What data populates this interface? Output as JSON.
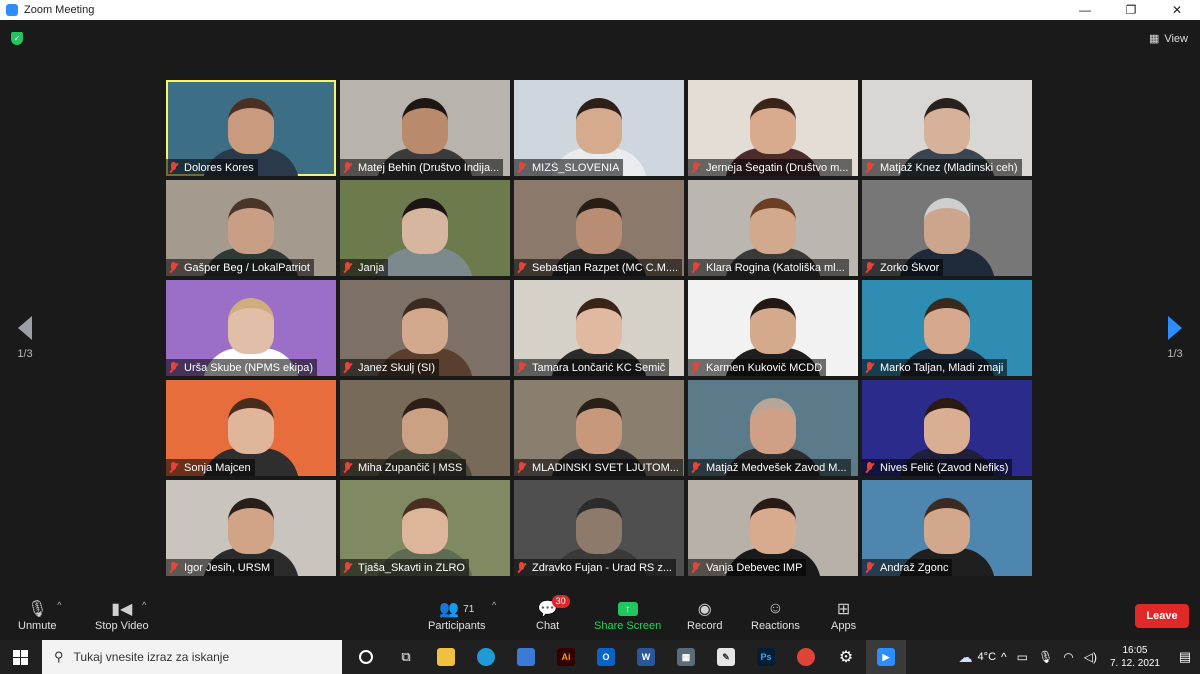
{
  "window": {
    "title": "Zoom Meeting",
    "controls": [
      "—",
      "❐",
      "✕"
    ]
  },
  "meeting": {
    "view_label": "View",
    "page_left": "1/3",
    "page_right": "1/3"
  },
  "participants": [
    {
      "name": "Dolores Kores",
      "bg": "#3c6f86",
      "skin": "#c99a7d",
      "hair": "#4a2f22",
      "shirt": "#2b3a4a",
      "active": true
    },
    {
      "name": "Matej Behin (Društvo Indija...",
      "bg": "#b8b3ad",
      "skin": "#b98a6c",
      "hair": "#1e1612",
      "shirt": "#3b3b3b"
    },
    {
      "name": "MIZŠ_SLOVENIA",
      "bg": "#cfd6de",
      "skin": "#d6ab8d",
      "hair": "#2e2018",
      "shirt": "#e9ecef"
    },
    {
      "name": "Jerneja Šegatin (Društvo m...",
      "bg": "#e3ddd5",
      "skin": "#d8ab8f",
      "hair": "#3a2318",
      "shirt": "#4a2c2a"
    },
    {
      "name": "Matjaž Knez (Mladinski ceh)",
      "bg": "#d9d7d3",
      "skin": "#d6b29a",
      "hair": "#2a211c",
      "shirt": "#3a4550"
    },
    {
      "name": "Gašper Beg / LokalPatriot",
      "bg": "#a59a8e",
      "skin": "#c89f84",
      "hair": "#4a3628",
      "shirt": "#2f3a36"
    },
    {
      "name": "Janja",
      "bg": "#6d7a4e",
      "skin": "#d7b6a0",
      "hair": "#1b1514",
      "shirt": "#7c8a8e"
    },
    {
      "name": "Sebastjan Razpet (MC C.M....",
      "bg": "#8b7a6b",
      "skin": "#b88d74",
      "hair": "#2a1d16",
      "shirt": "#2a2a2a"
    },
    {
      "name": "Klara Rogina (Katoliška ml...",
      "bg": "#bcb6b0",
      "skin": "#d3a98d",
      "hair": "#6a3f24",
      "shirt": "#3a3a3a"
    },
    {
      "name": "Zorko Škvor",
      "bg": "#777777",
      "skin": "#cda58d",
      "hair": "#cfcfcf",
      "shirt": "#1f2a3a"
    },
    {
      "name": "Urša Skube (NPMS ekipa)",
      "bg": "#9b6fc7",
      "skin": "#e1bea7",
      "hair": "#cfae7d",
      "shirt": "#ffffff"
    },
    {
      "name": "Janez Skulj (SI)",
      "bg": "#7d7066",
      "skin": "#d4a88c",
      "hair": "#3a2a1f",
      "shirt": "#5a3e2e"
    },
    {
      "name": "Tamara Lončarić  KC Semič",
      "bg": "#d6d1c8",
      "skin": "#e0b9a0",
      "hair": "#3a2418",
      "shirt": "#2a2a2a"
    },
    {
      "name": "Karmen Kukovič  MCDD",
      "bg": "#f2f2f2",
      "skin": "#d4a98c",
      "hair": "#241814",
      "shirt": "#1e1e1e"
    },
    {
      "name": "Marko Taljan, Mladi zmaji",
      "bg": "#2f8db3",
      "skin": "#d6a98f",
      "hair": "#3a2a1e",
      "shirt": "#1f2b3a"
    },
    {
      "name": "Sonja Majcen",
      "bg": "#e86d3c",
      "skin": "#e0b59a",
      "hair": "#4a2c1c",
      "shirt": "#2e2e2e"
    },
    {
      "name": "Miha Zupančič | MSS",
      "bg": "#776a58",
      "skin": "#cba184",
      "hair": "#2d1f17",
      "shirt": "#4a4a3a"
    },
    {
      "name": "MLADINSKI SVET LJUTOM...",
      "bg": "#8a7e6f",
      "skin": "#c8987c",
      "hair": "#2a2018",
      "shirt": "#2a2a2a"
    },
    {
      "name": "Matjaž Medvešek Zavod M...",
      "bg": "#5c7b8a",
      "skin": "#cfa085",
      "hair": "#b5a69a",
      "shirt": "#2c2c2c"
    },
    {
      "name": "Nives Felić (Zavod Nefiks)",
      "bg": "#2b2b8c",
      "skin": "#d9ae92",
      "hair": "#2b1a14",
      "shirt": "#1f1f3a"
    },
    {
      "name": "Igor Jesih, URSM",
      "bg": "#c9c4bd",
      "skin": "#d1a487",
      "hair": "#2a1f18",
      "shirt": "#2b2b2b"
    },
    {
      "name": "Tjaša_Skavti in ZLRO",
      "bg": "#7f8a63",
      "skin": "#dcb59a",
      "hair": "#4a2e1e",
      "shirt": "#5e6b55"
    },
    {
      "name": "Zdravko Fujan - Urad RS z...",
      "bg": "#4f4f4f",
      "skin": "#8e7a6a",
      "hair": "#2b2b2b",
      "shirt": "#3a3a3a"
    },
    {
      "name": "Vanja Debevec IMP",
      "bg": "#b8b1a8",
      "skin": "#d8ab8f",
      "hair": "#2a1a16",
      "shirt": "#1a1a1a"
    },
    {
      "name": "Andraž Zgonc",
      "bg": "#4f86b0",
      "skin": "#d2a78c",
      "hair": "#3b2a1f",
      "shirt": "#1f1f1f"
    }
  ],
  "toolbar": {
    "unmute": "Unmute",
    "stop_video": "Stop Video",
    "participants": "Participants",
    "participants_count": "71",
    "chat": "Chat",
    "chat_badge": "30",
    "share_screen": "Share Screen",
    "record": "Record",
    "reactions": "Reactions",
    "apps": "Apps",
    "leave": "Leave"
  },
  "taskbar": {
    "search_placeholder": "Tukaj vnesite izraz za iskanje",
    "weather": "4°C",
    "time": "16:05",
    "date": "7. 12. 2021"
  }
}
